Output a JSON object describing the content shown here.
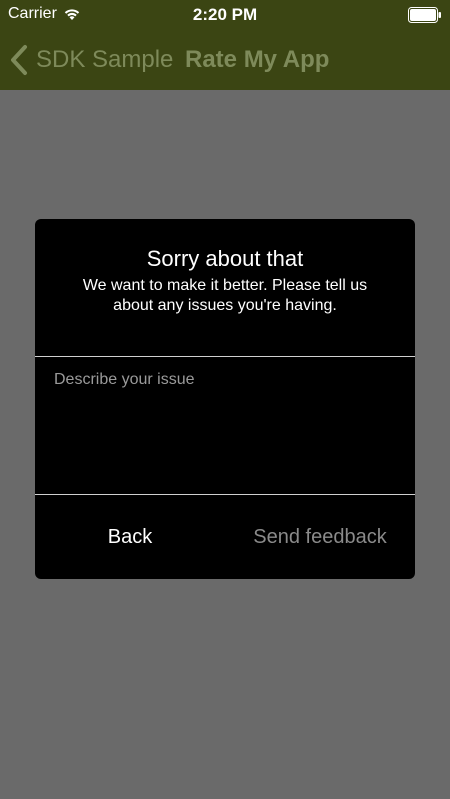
{
  "status_bar": {
    "carrier": "Carrier",
    "time": "2:20 PM",
    "wifi_icon": "wifi-icon",
    "battery_icon": "battery-icon"
  },
  "nav": {
    "back_label": "SDK Sample",
    "title": "Rate My App",
    "back_icon": "chevron-left-icon"
  },
  "dialog": {
    "title": "Sorry about that",
    "message": "We want to make it better. Please tell us about any issues you're having.",
    "issue_placeholder": "Describe your issue",
    "issue_value": "",
    "back_button": "Back",
    "send_button": "Send feedback"
  },
  "colors": {
    "nav_background": "#3b4513",
    "nav_text": "#7e8a5a",
    "overlay": "#6a6a6a",
    "dialog_background": "#000000",
    "disabled_text": "#8a8a8a"
  }
}
